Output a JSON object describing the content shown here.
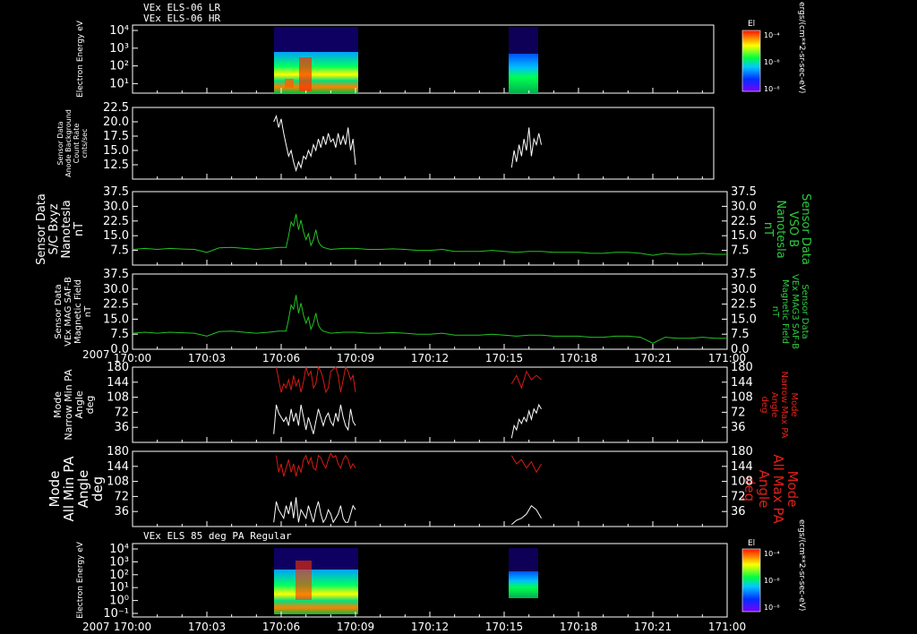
{
  "titles": {
    "top1": "VEx ELS-06 LR",
    "top2": "VEx ELS-06 HR",
    "bottom": "VEx ELS 85 deg PA Regular"
  },
  "colorbar": {
    "title": "El",
    "ticks": [
      "10⁻⁴",
      "10⁻⁶",
      "10⁻⁸"
    ],
    "unit": "ergs/(cm**2-sr-sec-eV)"
  },
  "time_axis": {
    "year": "2007",
    "ticks": [
      "170:00",
      "170:03",
      "170:06",
      "170:09",
      "170:12",
      "170:15",
      "170:18",
      "170:21",
      "171:00"
    ]
  },
  "colors": {
    "magnetic": "#22c422",
    "max_pa": "#d81a14",
    "min_pa": "#ffffff",
    "frame": "#ffffff",
    "background": "#000000"
  },
  "chart_data": [
    {
      "panel": "electron-spectrogram-top",
      "type": "heatmap",
      "ylabel": "Electron Energy eV",
      "yscale": "log",
      "yticks": [
        "10⁴",
        "10³",
        "10²",
        "10¹"
      ],
      "ylim": [
        1,
        20000
      ],
      "active_intervals": [
        [
          "170:05.7",
          "170:09.0"
        ],
        [
          "170:15.3",
          "170:16.5"
        ]
      ],
      "colorbar_range": [
        "10⁻⁹",
        "10⁻⁴"
      ]
    },
    {
      "panel": "anode-background",
      "type": "line",
      "ylabel_lines": [
        "Sensor Data",
        "Anode Background",
        "Count Rate",
        "cnts/sec"
      ],
      "yticks": [
        "22.5",
        "20.0",
        "17.5",
        "15.0",
        "12.5"
      ],
      "ylim": [
        10,
        22.5
      ],
      "series": [
        {
          "color": "#ffffff",
          "x": [
            5.7,
            5.8,
            5.9,
            6.0,
            6.1,
            6.2,
            6.3,
            6.4,
            6.5,
            6.6,
            6.7,
            6.8,
            6.9,
            7.0,
            7.1,
            7.2,
            7.3,
            7.4,
            7.5,
            7.6,
            7.7,
            7.8,
            7.9,
            8.0,
            8.1,
            8.2,
            8.3,
            8.4,
            8.5,
            8.6,
            8.7,
            8.8,
            8.9,
            9.0
          ],
          "y": [
            20,
            21,
            19,
            20.5,
            18,
            16,
            14,
            15,
            13,
            11.5,
            13,
            12,
            14,
            13.5,
            15,
            14,
            16,
            15,
            17,
            15.5,
            17.5,
            16,
            18,
            16.5,
            17,
            15.5,
            18,
            16,
            17.5,
            16,
            19,
            15,
            17,
            12.5
          ]
        },
        {
          "color": "#ffffff",
          "x": [
            15.3,
            15.4,
            15.5,
            15.6,
            15.7,
            15.8,
            15.9,
            16.0,
            16.1,
            16.2,
            16.3,
            16.4,
            16.5
          ],
          "y": [
            12,
            15,
            13,
            16,
            14,
            17,
            15,
            19,
            14,
            17,
            16,
            18,
            16
          ]
        }
      ]
    },
    {
      "panel": "bxyz-sc",
      "type": "line",
      "ylabel_left": [
        "Sensor Data",
        "S/C Bxyz",
        "Nanotesla",
        "nT"
      ],
      "ylabel_right": [
        "Sensor Data",
        "VSO B",
        "Nanotesla",
        "nT"
      ],
      "yticks": [
        "37.5",
        "30.0",
        "22.5",
        "15.0",
        "7.5"
      ],
      "ylim": [
        0,
        37.5
      ],
      "series": [
        {
          "color": "#22c422",
          "x": [
            0,
            0.5,
            1,
            1.5,
            2,
            2.5,
            3,
            3.5,
            4,
            4.5,
            5,
            5.5,
            5.9,
            6.2,
            6.3,
            6.4,
            6.5,
            6.6,
            6.7,
            6.8,
            6.9,
            7.0,
            7.1,
            7.2,
            7.3,
            7.4,
            7.5,
            7.6,
            7.7,
            8,
            8.5,
            9,
            9.5,
            10,
            10.5,
            11,
            11.5,
            12,
            12.5,
            13,
            13.5,
            14,
            14.5,
            15,
            15.5,
            16,
            16.5,
            17,
            17.5,
            18,
            18.5,
            19,
            19.5,
            20,
            20.5,
            21,
            21.5,
            22,
            22.5,
            23,
            23.5,
            24
          ],
          "y": [
            8,
            8.5,
            8,
            8.5,
            8.2,
            8,
            6.5,
            8.8,
            9,
            8.5,
            8,
            8.5,
            9,
            9,
            15,
            22,
            20,
            26,
            18,
            23,
            17,
            13,
            16,
            10,
            13,
            18,
            12,
            10,
            9,
            8,
            8.5,
            8.5,
            8,
            8,
            8.3,
            8,
            7.5,
            7.5,
            8,
            7,
            7,
            7,
            7.5,
            7,
            6.5,
            7,
            7,
            6.5,
            6.5,
            6.5,
            6,
            6,
            6.5,
            6.5,
            6,
            5,
            6,
            5.5,
            5.5,
            6,
            5.5,
            5.5
          ]
        }
      ]
    },
    {
      "panel": "mag-saf-b",
      "type": "line",
      "ylabel_left": [
        "Sensor Data",
        "VEx MAG SAF-B",
        "Magnetic Field",
        "nT"
      ],
      "ylabel_right": [
        "Sensor Data",
        "VEx MAG3 SAF-B",
        "Magnetic Field",
        "nT"
      ],
      "yticks": [
        "37.5",
        "30.0",
        "22.5",
        "15.0",
        "7.5",
        "0.0"
      ],
      "ylim": [
        0,
        37.5
      ],
      "series": [
        {
          "color": "#22c422",
          "x": [
            0,
            0.5,
            1,
            1.5,
            2,
            2.5,
            3,
            3.5,
            4,
            4.5,
            5,
            5.5,
            5.9,
            6.2,
            6.3,
            6.4,
            6.5,
            6.6,
            6.7,
            6.8,
            6.9,
            7.0,
            7.1,
            7.2,
            7.3,
            7.4,
            7.5,
            7.6,
            7.7,
            8,
            8.5,
            9,
            9.5,
            10,
            10.5,
            11,
            11.5,
            12,
            12.5,
            13,
            13.5,
            14,
            14.5,
            15,
            15.5,
            16,
            16.5,
            17,
            17.5,
            18,
            18.5,
            19,
            19.5,
            20,
            20.5,
            21,
            21.5,
            22,
            22.5,
            23,
            23.5,
            24
          ],
          "y": [
            8,
            8.5,
            8,
            8.5,
            8.2,
            8,
            6.5,
            8.8,
            9,
            8.5,
            8,
            8.5,
            9,
            9,
            15,
            22,
            20,
            27,
            18,
            23,
            17,
            13,
            16,
            10,
            13,
            18,
            12,
            10,
            9,
            8,
            8.5,
            8.5,
            8,
            8,
            8.3,
            8,
            7.5,
            7.5,
            8,
            7,
            7,
            7,
            7.5,
            7,
            6.5,
            7,
            7,
            6.5,
            6.5,
            6.5,
            6,
            6,
            6.5,
            6.5,
            6,
            3,
            6,
            5.5,
            5.5,
            6,
            5.5,
            5.5
          ]
        }
      ]
    },
    {
      "panel": "narrow-pa",
      "type": "line",
      "ylabel_left": [
        "Mode",
        "Narrow Min PA",
        "Angle",
        "deg"
      ],
      "ylabel_right": [
        "Mode",
        "Narrow Max PA",
        "Angle",
        "deg"
      ],
      "yticks": [
        "180",
        "144",
        "108",
        "72",
        "36"
      ],
      "ylim": [
        0,
        180
      ],
      "series": [
        {
          "color": "#d81a14",
          "x": [
            5.8,
            5.9,
            6.0,
            6.1,
            6.2,
            6.3,
            6.4,
            6.5,
            6.6,
            6.7,
            6.8,
            6.9,
            7.0,
            7.1,
            7.2,
            7.3,
            7.4,
            7.5,
            7.6,
            7.7,
            7.8,
            7.9,
            8.0,
            8.1,
            8.2,
            8.3,
            8.4,
            8.5,
            8.6,
            8.7,
            8.8,
            8.9,
            9.0
          ],
          "y": [
            180,
            150,
            120,
            140,
            130,
            150,
            125,
            160,
            135,
            150,
            120,
            145,
            180,
            160,
            170,
            130,
            140,
            180,
            170,
            150,
            120,
            130,
            170,
            175,
            180,
            160,
            120,
            150,
            180,
            170,
            150,
            160,
            120
          ]
        },
        {
          "color": "#d81a14",
          "x": [
            15.3,
            15.5,
            15.7,
            15.9,
            16.1,
            16.3,
            16.5
          ],
          "y": [
            140,
            160,
            130,
            170,
            150,
            160,
            150
          ]
        },
        {
          "color": "#ffffff",
          "x": [
            5.7,
            5.8,
            5.9,
            6.0,
            6.1,
            6.2,
            6.3,
            6.4,
            6.5,
            6.6,
            6.7,
            6.8,
            6.9,
            7.0,
            7.1,
            7.2,
            7.3,
            7.4,
            7.5,
            7.6,
            7.7,
            7.8,
            7.9,
            8.0,
            8.1,
            8.2,
            8.3,
            8.4,
            8.5,
            8.6,
            8.7,
            8.8,
            8.9,
            9.0
          ],
          "y": [
            20,
            90,
            70,
            60,
            50,
            60,
            40,
            80,
            50,
            70,
            40,
            90,
            60,
            30,
            60,
            40,
            20,
            50,
            80,
            60,
            40,
            60,
            70,
            50,
            40,
            70,
            50,
            90,
            60,
            40,
            30,
            80,
            50,
            40
          ]
        },
        {
          "color": "#ffffff",
          "x": [
            15.3,
            15.4,
            15.5,
            15.6,
            15.7,
            15.8,
            15.9,
            16.0,
            16.1,
            16.2,
            16.3,
            16.4,
            16.5
          ],
          "y": [
            10,
            40,
            30,
            55,
            45,
            60,
            50,
            75,
            55,
            80,
            70,
            90,
            80
          ]
        }
      ]
    },
    {
      "panel": "all-pa",
      "type": "line",
      "ylabel_left": [
        "Mode",
        "All Min PA",
        "Angle",
        "deg"
      ],
      "ylabel_right": [
        "Mode",
        "All Max PA",
        "Angle",
        "deg"
      ],
      "yticks": [
        "180",
        "144",
        "108",
        "72",
        "36"
      ],
      "ylim": [
        0,
        180
      ],
      "series": [
        {
          "color": "#d81a14",
          "x": [
            5.8,
            5.9,
            6.0,
            6.1,
            6.2,
            6.3,
            6.4,
            6.5,
            6.6,
            6.7,
            6.8,
            6.9,
            7.0,
            7.1,
            7.2,
            7.3,
            7.4,
            7.5,
            7.6,
            7.7,
            7.8,
            7.9,
            8.0,
            8.1,
            8.2,
            8.3,
            8.4,
            8.5,
            8.6,
            8.7,
            8.8,
            8.9,
            9.0
          ],
          "y": [
            170,
            130,
            150,
            120,
            140,
            160,
            130,
            150,
            120,
            145,
            130,
            160,
            170,
            150,
            165,
            140,
            135,
            170,
            165,
            150,
            140,
            160,
            175,
            165,
            170,
            150,
            140,
            160,
            170,
            160,
            140,
            150,
            140
          ]
        },
        {
          "color": "#d81a14",
          "x": [
            15.3,
            15.5,
            15.7,
            15.9,
            16.1,
            16.3,
            16.5
          ],
          "y": [
            170,
            150,
            160,
            140,
            155,
            130,
            150
          ]
        },
        {
          "color": "#ffffff",
          "x": [
            5.7,
            5.8,
            5.9,
            6.0,
            6.1,
            6.2,
            6.3,
            6.4,
            6.5,
            6.6,
            6.7,
            6.8,
            6.9,
            7.0,
            7.1,
            7.2,
            7.3,
            7.4,
            7.5,
            7.6,
            7.7,
            7.8,
            7.9,
            8.0,
            8.1,
            8.2,
            8.3,
            8.4,
            8.5,
            8.6,
            8.7,
            8.8,
            8.9,
            9.0
          ],
          "y": [
            10,
            60,
            40,
            30,
            20,
            50,
            30,
            60,
            20,
            70,
            10,
            40,
            30,
            20,
            50,
            30,
            10,
            40,
            60,
            30,
            10,
            20,
            40,
            30,
            10,
            20,
            30,
            50,
            20,
            10,
            10,
            30,
            50,
            40
          ]
        },
        {
          "color": "#ffffff",
          "x": [
            15.3,
            15.5,
            15.7,
            15.9,
            16.1,
            16.3,
            16.5
          ],
          "y": [
            5,
            15,
            20,
            30,
            50,
            40,
            20
          ]
        }
      ]
    },
    {
      "panel": "electron-spectrogram-bottom",
      "type": "heatmap",
      "ylabel": "Electron Energy eV",
      "yscale": "log",
      "yticks": [
        "10⁴",
        "10³",
        "10²",
        "10¹",
        "10⁰",
        "10⁻¹"
      ],
      "ylim": [
        0.1,
        20000
      ],
      "active_intervals": [
        [
          "170:05.7",
          "170:09.0"
        ],
        [
          "170:15.3",
          "170:16.5"
        ]
      ],
      "colorbar_range": [
        "10⁻⁹",
        "10⁻⁴"
      ]
    }
  ]
}
